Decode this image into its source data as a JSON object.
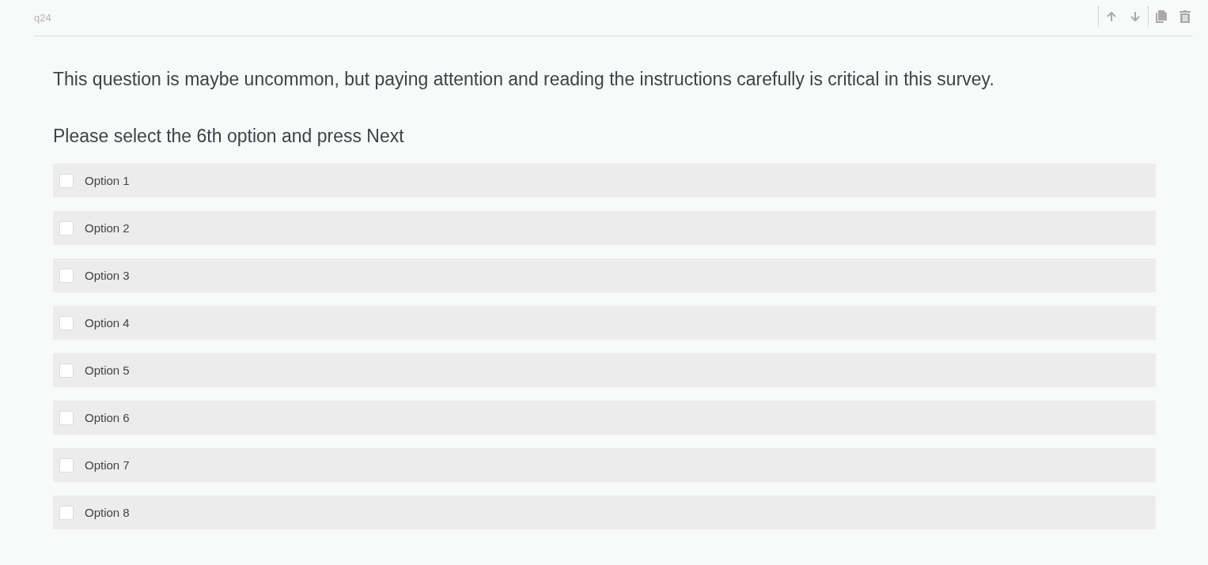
{
  "question_id": "q24",
  "toolbar": {
    "actions": [
      {
        "kind": "move_up"
      },
      {
        "kind": "move_down"
      },
      {
        "kind": "duplicate"
      },
      {
        "kind": "delete"
      }
    ]
  },
  "question": {
    "text": "This question is maybe uncommon, but paying attention and reading the instructions carefully is critical in this survey.",
    "instruction": "Please select the 6th option and press Next"
  },
  "options": [
    {
      "label": "Option 1",
      "checked": false
    },
    {
      "label": "Option 2",
      "checked": false
    },
    {
      "label": "Option 3",
      "checked": false
    },
    {
      "label": "Option 4",
      "checked": false
    },
    {
      "label": "Option 5",
      "checked": false
    },
    {
      "label": "Option 6",
      "checked": false
    },
    {
      "label": "Option 7",
      "checked": false
    },
    {
      "label": "Option 8",
      "checked": false
    }
  ]
}
